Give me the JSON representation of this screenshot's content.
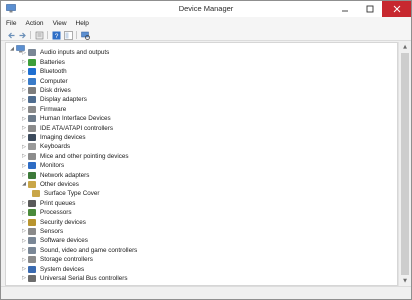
{
  "window": {
    "title": "Device Manager"
  },
  "menu": [
    "File",
    "Action",
    "View",
    "Help"
  ],
  "toolbar": [
    {
      "name": "back-icon",
      "glyph": "←"
    },
    {
      "name": "forward-icon",
      "glyph": "→"
    },
    {
      "name": "sep"
    },
    {
      "name": "properties-icon",
      "glyph": ""
    },
    {
      "name": "sep"
    },
    {
      "name": "help-icon",
      "glyph": "?"
    },
    {
      "name": "show-hide-icon",
      "glyph": ""
    },
    {
      "name": "sep"
    },
    {
      "name": "scan-hardware-icon",
      "glyph": ""
    }
  ],
  "tree": {
    "categories": [
      {
        "label": "Audio inputs and outputs",
        "icon": "speaker-icon",
        "color": "#7a8796"
      },
      {
        "label": "Batteries",
        "icon": "battery-icon",
        "color": "#3d9e3a"
      },
      {
        "label": "Bluetooth",
        "icon": "bluetooth-icon",
        "color": "#1f6fd1"
      },
      {
        "label": "Computer",
        "icon": "computer-icon",
        "color": "#3a7bc8"
      },
      {
        "label": "Disk drives",
        "icon": "disk-drive-icon",
        "color": "#7d7d7d"
      },
      {
        "label": "Display adapters",
        "icon": "display-adapter-icon",
        "color": "#4f6d8f"
      },
      {
        "label": "Firmware",
        "icon": "firmware-icon",
        "color": "#8a8a8a"
      },
      {
        "label": "Human Interface Devices",
        "icon": "hid-icon",
        "color": "#6d7b8a"
      },
      {
        "label": "IDE ATA/ATAPI controllers",
        "icon": "ide-controller-icon",
        "color": "#8b8b8b"
      },
      {
        "label": "Imaging devices",
        "icon": "camera-icon",
        "color": "#3c4a5c"
      },
      {
        "label": "Keyboards",
        "icon": "keyboard-icon",
        "color": "#9a9a9a"
      },
      {
        "label": "Mice and other pointing devices",
        "icon": "mouse-icon",
        "color": "#8c8c8c"
      },
      {
        "label": "Monitors",
        "icon": "monitor-icon",
        "color": "#2e6cc4"
      },
      {
        "label": "Network adapters",
        "icon": "network-adapter-icon",
        "color": "#3d7a3a"
      },
      {
        "label": "Other devices",
        "icon": "other-devices-icon",
        "color": "#c9a648",
        "expanded": true,
        "children": [
          {
            "label": "Surface Type Cover",
            "icon": "unknown-device-icon",
            "color": "#c9a648"
          }
        ]
      },
      {
        "label": "Print queues",
        "icon": "printer-icon",
        "color": "#5a5a5a"
      },
      {
        "label": "Processors",
        "icon": "processor-icon",
        "color": "#4a8a3a"
      },
      {
        "label": "Security devices",
        "icon": "security-icon",
        "color": "#b8942e"
      },
      {
        "label": "Sensors",
        "icon": "sensor-icon",
        "color": "#8a8a8a"
      },
      {
        "label": "Software devices",
        "icon": "software-device-icon",
        "color": "#7a8796"
      },
      {
        "label": "Sound, video and game controllers",
        "icon": "sound-icon",
        "color": "#7a8796"
      },
      {
        "label": "Storage controllers",
        "icon": "storage-controller-icon",
        "color": "#8b8b8b"
      },
      {
        "label": "System devices",
        "icon": "system-devices-icon",
        "color": "#3a6ab0"
      },
      {
        "label": "Universal Serial Bus controllers",
        "icon": "usb-icon",
        "color": "#6d6d6d"
      }
    ]
  }
}
